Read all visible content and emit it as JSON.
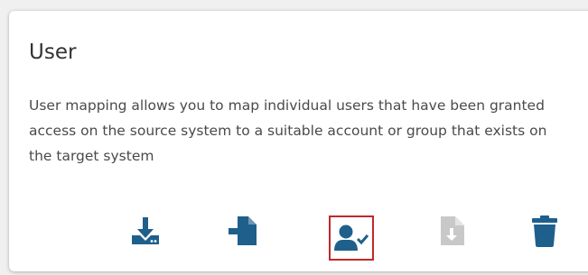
{
  "card": {
    "title": "User",
    "description": "User mapping allows you to map individual users that have been granted access on the source system to a suitable account or group that exists on the target system"
  },
  "actions": [
    {
      "icon": "download-icon",
      "state": "enabled"
    },
    {
      "icon": "file-import-icon",
      "state": "enabled"
    },
    {
      "icon": "user-check-icon",
      "state": "selected"
    },
    {
      "icon": "file-download-icon",
      "state": "disabled"
    },
    {
      "icon": "trash-icon",
      "state": "enabled"
    }
  ],
  "colors": {
    "icon": "#1f5f8b",
    "icon_disabled": "#c8c8c8",
    "selected_border": "#c0282b",
    "title": "#333333",
    "text": "#4a4a4a"
  }
}
